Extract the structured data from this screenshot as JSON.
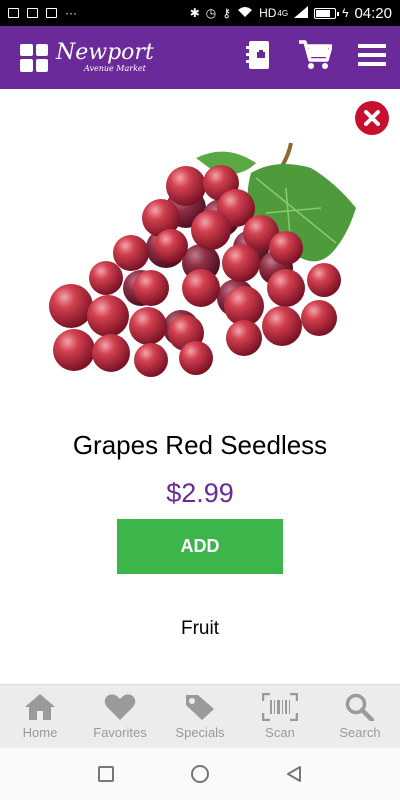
{
  "status_bar": {
    "network": "HD",
    "network_type": "4G",
    "time": "04:20",
    "battery_level": 0.85
  },
  "header": {
    "logo_text": "Newport",
    "logo_subtext": "Avenue Market"
  },
  "product": {
    "name": "Grapes Red Seedless",
    "price": "$2.99",
    "add_label": "ADD",
    "category": "Fruit"
  },
  "bottom_nav": {
    "items": [
      {
        "label": "Home",
        "icon": "home-icon"
      },
      {
        "label": "Favorites",
        "icon": "heart-icon"
      },
      {
        "label": "Specials",
        "icon": "tag-icon"
      },
      {
        "label": "Scan",
        "icon": "barcode-icon"
      },
      {
        "label": "Search",
        "icon": "search-icon"
      }
    ]
  },
  "colors": {
    "brand_purple": "#6a2a9a",
    "add_green": "#3cb54a",
    "close_red": "#c8102e",
    "nav_gray": "#9a9a9a"
  }
}
